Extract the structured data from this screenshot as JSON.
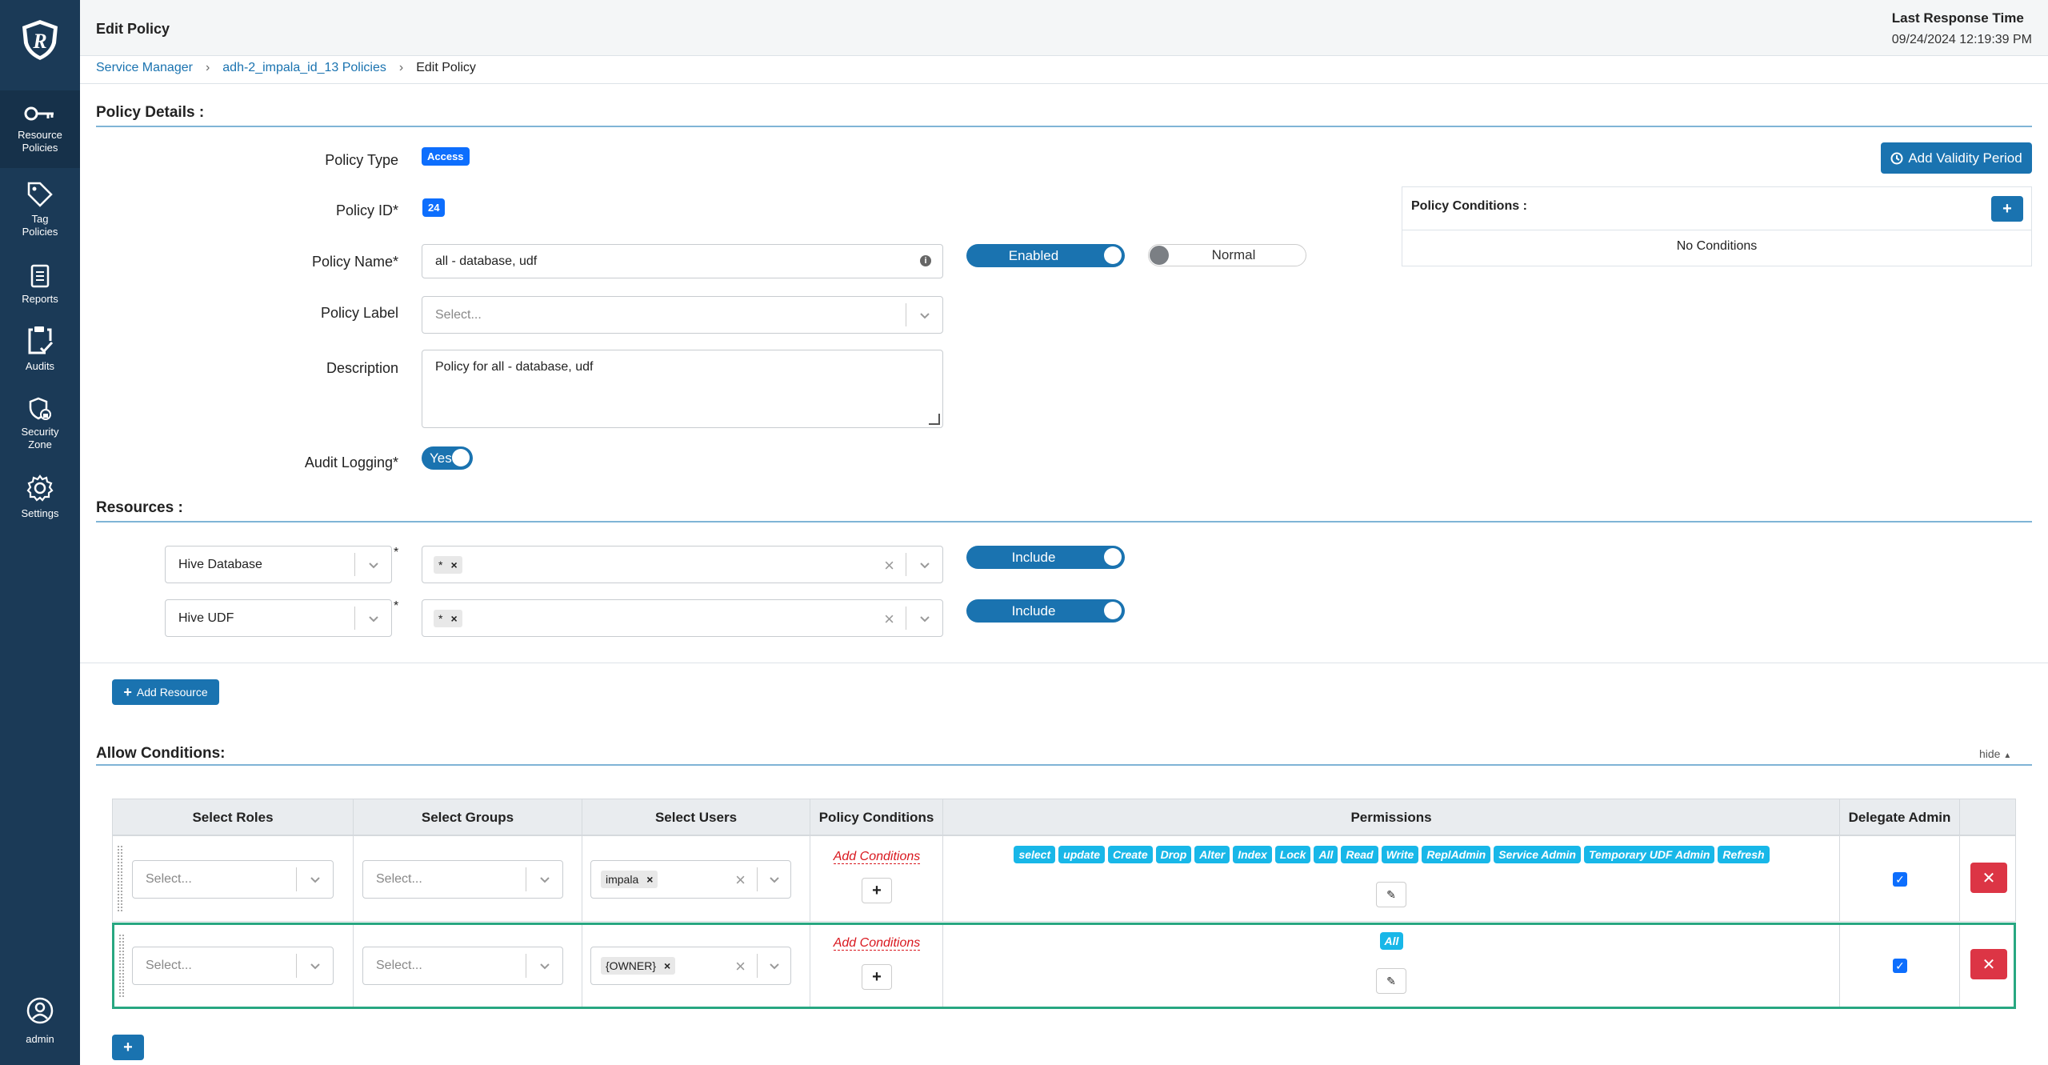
{
  "sidebar": {
    "items": [
      {
        "label_1": "Resource",
        "label_2": "Policies",
        "icon": "key-icon"
      },
      {
        "label_1": "Tag",
        "label_2": "Policies",
        "icon": "tag-icon"
      },
      {
        "label_1": "Reports",
        "label_2": "",
        "icon": "report-icon"
      },
      {
        "label_1": "Audits",
        "label_2": "",
        "icon": "clipboard-check-icon"
      },
      {
        "label_1": "Security",
        "label_2": "Zone",
        "icon": "shield-lock-icon"
      },
      {
        "label_1": "Settings",
        "label_2": "",
        "icon": "gear-icon"
      }
    ],
    "user": "admin"
  },
  "header": {
    "title": "Edit Policy",
    "response_label": "Last Response Time",
    "response_value": "09/24/2024 12:19:39 PM"
  },
  "breadcrumb": [
    "Service Manager",
    "adh-2_impala_id_13 Policies",
    "Edit Policy"
  ],
  "policy_details": {
    "section_title": "Policy Details :",
    "policy_type_label": "Policy Type",
    "policy_type_value": "Access",
    "policy_id_label": "Policy ID*",
    "policy_id_value": "24",
    "policy_name_label": "Policy Name*",
    "policy_name_value": "all - database, udf",
    "enabled_label": "Enabled",
    "normal_label": "Normal",
    "policy_label_label": "Policy Label",
    "policy_label_placeholder": "Select...",
    "description_label": "Description",
    "description_value": "Policy for all - database, udf",
    "audit_logging_label": "Audit Logging*",
    "audit_logging_value": "Yes",
    "add_validity_label": "Add Validity Period",
    "conditions_title": "Policy Conditions :",
    "no_conditions": "No Conditions"
  },
  "resources": {
    "section_title": "Resources :",
    "rows": [
      {
        "type": "Hive Database",
        "value": "*",
        "mode": "Include"
      },
      {
        "type": "Hive UDF",
        "value": "*",
        "mode": "Include"
      }
    ],
    "add_resource_label": "Add Resource"
  },
  "allow_conditions": {
    "section_title": "Allow Conditions:",
    "hide_label": "hide",
    "headers": [
      "Select Roles",
      "Select Groups",
      "Select Users",
      "Policy Conditions",
      "Permissions",
      "Delegate Admin"
    ],
    "select_placeholder": "Select...",
    "add_conditions_label": "Add Conditions",
    "rows": [
      {
        "user": "impala",
        "permissions": [
          "select",
          "update",
          "Create",
          "Drop",
          "Alter",
          "Index",
          "Lock",
          "All",
          "Read",
          "Write",
          "ReplAdmin",
          "Service Admin",
          "Temporary UDF Admin",
          "Refresh"
        ],
        "delegate_admin": true
      },
      {
        "user": "{OWNER}",
        "permissions": [
          "All"
        ],
        "delegate_admin": true
      }
    ]
  },
  "colors": {
    "sidebar_bg": "#1b3a57",
    "primary": "#1a73b0",
    "permission_tag": "#18b7e8",
    "danger": "#dc3545",
    "selected_row_border": "#28a781"
  }
}
